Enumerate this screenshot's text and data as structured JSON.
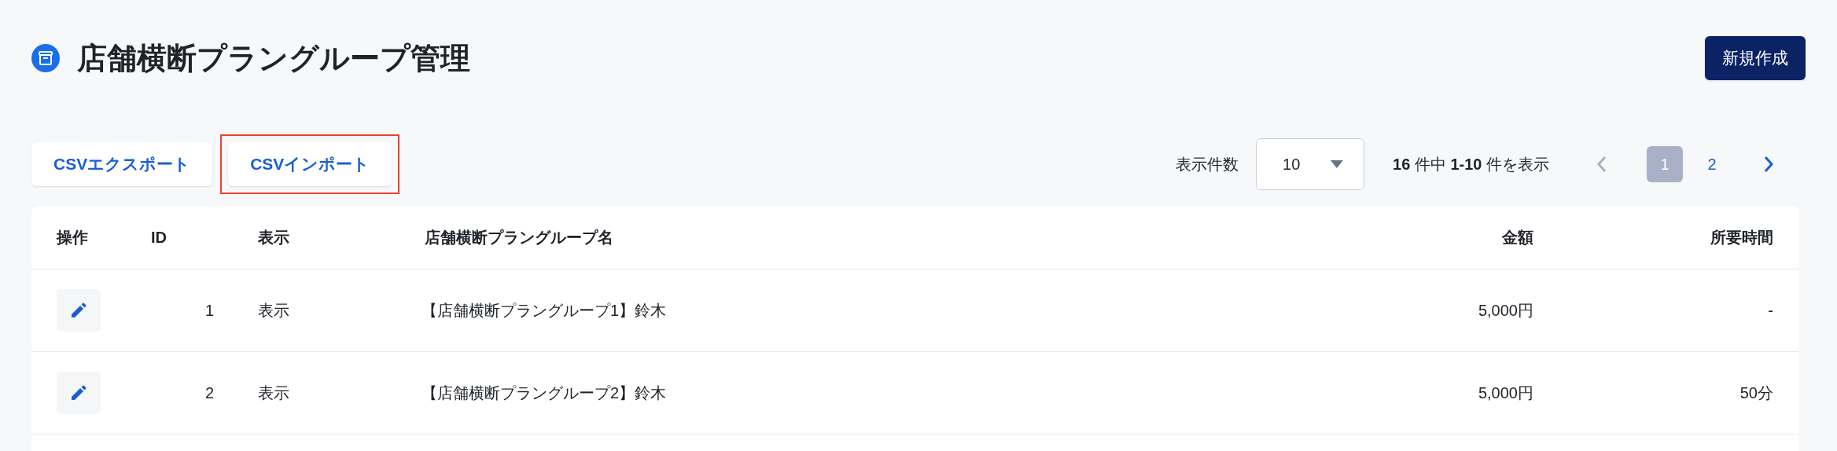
{
  "page": {
    "title": "店舗横断プラングループ管理",
    "create_button": "新規作成"
  },
  "toolbar": {
    "buttons": [
      {
        "label": "CSVエクスポート",
        "highlighted": false
      },
      {
        "label": "CSVインポート",
        "highlighted": true
      }
    ],
    "page_size_label": "表示件数",
    "page_size": "10",
    "summary": "**16** 件中 **1-10** 件を表示",
    "pagination": {
      "prev_disabled": true,
      "pages": [
        {
          "label": "1",
          "selected": true
        },
        {
          "label": "2",
          "selected": false
        }
      ],
      "next_disabled": false
    }
  },
  "table": {
    "columns": [
      "操作",
      "ID",
      "表示",
      "店舗横断プラングループ名",
      "金額",
      "所要時間"
    ],
    "rows": [
      {
        "id": "1",
        "visibility": "表示",
        "name": "【店舗横断プラングループ1】鈴木",
        "price": "5,000円",
        "duration": "-"
      },
      {
        "id": "2",
        "visibility": "表示",
        "name": "【店舗横断プラングループ2】鈴木",
        "price": "5,000円",
        "duration": "50分"
      }
    ]
  }
}
